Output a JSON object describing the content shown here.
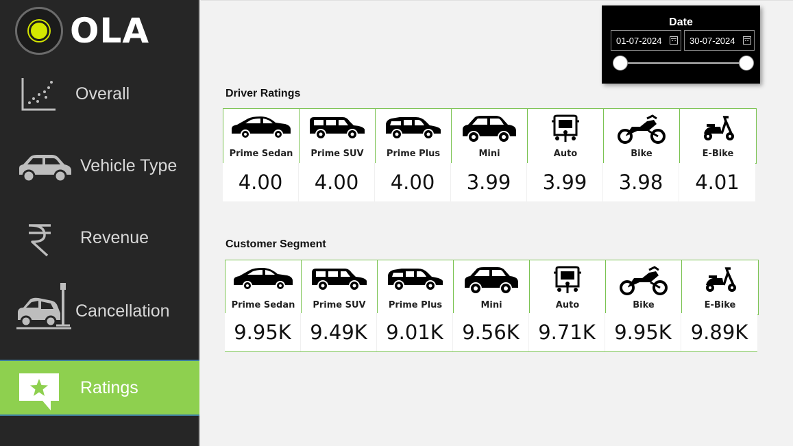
{
  "brand": {
    "name": "OLA"
  },
  "nav": {
    "items": [
      {
        "label": "Overall",
        "icon": "scatter-chart-icon"
      },
      {
        "label": "Vehicle Type",
        "icon": "car-icon"
      },
      {
        "label": "Revenue",
        "icon": "rupee-icon"
      },
      {
        "label": "Cancellation",
        "icon": "car-crash-icon"
      },
      {
        "label": "Ratings",
        "icon": "star-chat-icon",
        "active": true
      }
    ]
  },
  "date_filter": {
    "title": "Date",
    "start": "01-07-2024",
    "end": "30-07-2024"
  },
  "driver_ratings": {
    "title": "Driver Ratings",
    "cards": [
      {
        "label": "Prime Sedan",
        "value": "4.00",
        "icon": "sedan-icon"
      },
      {
        "label": "Prime SUV",
        "value": "4.00",
        "icon": "suv-icon"
      },
      {
        "label": "Prime Plus",
        "value": "4.00",
        "icon": "hatchback-icon"
      },
      {
        "label": "Mini",
        "value": "3.99",
        "icon": "mini-car-icon"
      },
      {
        "label": "Auto",
        "value": "3.99",
        "icon": "auto-rickshaw-icon"
      },
      {
        "label": "Bike",
        "value": "3.98",
        "icon": "motorbike-icon"
      },
      {
        "label": "E-Bike",
        "value": "4.01",
        "icon": "scooter-icon"
      }
    ]
  },
  "customer_segment": {
    "title": "Customer Segment",
    "cards": [
      {
        "label": "Prime Sedan",
        "value": "9.95K",
        "icon": "sedan-icon"
      },
      {
        "label": "Prime SUV",
        "value": "9.49K",
        "icon": "suv-icon"
      },
      {
        "label": "Prime Plus",
        "value": "9.01K",
        "icon": "hatchback-icon"
      },
      {
        "label": "Mini",
        "value": "9.56K",
        "icon": "mini-car-icon"
      },
      {
        "label": "Auto",
        "value": "9.71K",
        "icon": "auto-rickshaw-icon"
      },
      {
        "label": "Bike",
        "value": "9.95K",
        "icon": "motorbike-icon"
      },
      {
        "label": "E-Bike",
        "value": "9.89K",
        "icon": "scooter-icon"
      }
    ]
  },
  "colors": {
    "accent": "#8ed04f",
    "sidebar": "#262626",
    "card_border": "#7bc352"
  }
}
